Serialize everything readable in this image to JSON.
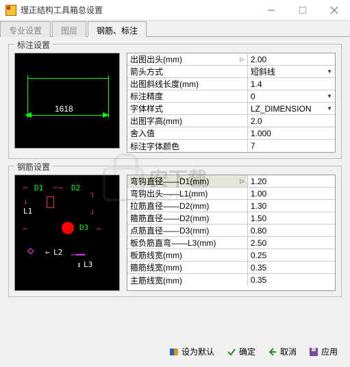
{
  "window": {
    "title": "理正结构工具箱总设置"
  },
  "tabs": [
    {
      "label": "专业设置",
      "active": false
    },
    {
      "label": "图层",
      "active": false
    },
    {
      "label": "钢筋、标注",
      "active": true
    }
  ],
  "group1": {
    "title": "标注设置",
    "dim_value": "1618",
    "rows": [
      {
        "label": "出图出头(mm)",
        "value": "2.00",
        "dd": true
      },
      {
        "label": "箭头方式",
        "value": "短斜线",
        "dd": true
      },
      {
        "label": "出图斜线长度(mm)",
        "value": "1.4"
      },
      {
        "label": "标注精度",
        "value": "0",
        "dd": true
      },
      {
        "label": "字体样式",
        "value": "LZ_DIMENSION",
        "dd": true
      },
      {
        "label": "出图字高(mm)",
        "value": "2.0"
      },
      {
        "label": "舍入值",
        "value": "1.000"
      },
      {
        "label": "标注字体颜色",
        "value": "7"
      }
    ]
  },
  "group2": {
    "title": "钢筋设置",
    "labels": {
      "D1": "D1",
      "D2": "D2",
      "D3": "D3",
      "L1": "L1",
      "L2": "L2",
      "L3": "L3"
    },
    "rows": [
      {
        "label": "弯钩直径——D1(mm)",
        "value": "1.20",
        "hl": true,
        "dd": true
      },
      {
        "label": "弯钩出头——L1(mm)",
        "value": "1.00"
      },
      {
        "label": "拉筋直径——D2(mm)",
        "value": "1.30"
      },
      {
        "label": "箍筋直径——D2(mm)",
        "value": "1.50"
      },
      {
        "label": "点筋直径——D3(mm)",
        "value": "0.80"
      },
      {
        "label": "板负筋直弯——L3(mm)",
        "value": "2.50"
      },
      {
        "label": "板筋线宽(mm)",
        "value": "0.25"
      },
      {
        "label": "箍筋线宽(mm)",
        "value": "0.35"
      },
      {
        "label": "主筋线宽(mm)",
        "value": "0.35"
      }
    ]
  },
  "footer": {
    "default": "设为默认",
    "ok": "确定",
    "cancel": "取消",
    "apply": "应用"
  },
  "watermark": {
    "text": "安下载",
    "url": "anxz.com"
  }
}
